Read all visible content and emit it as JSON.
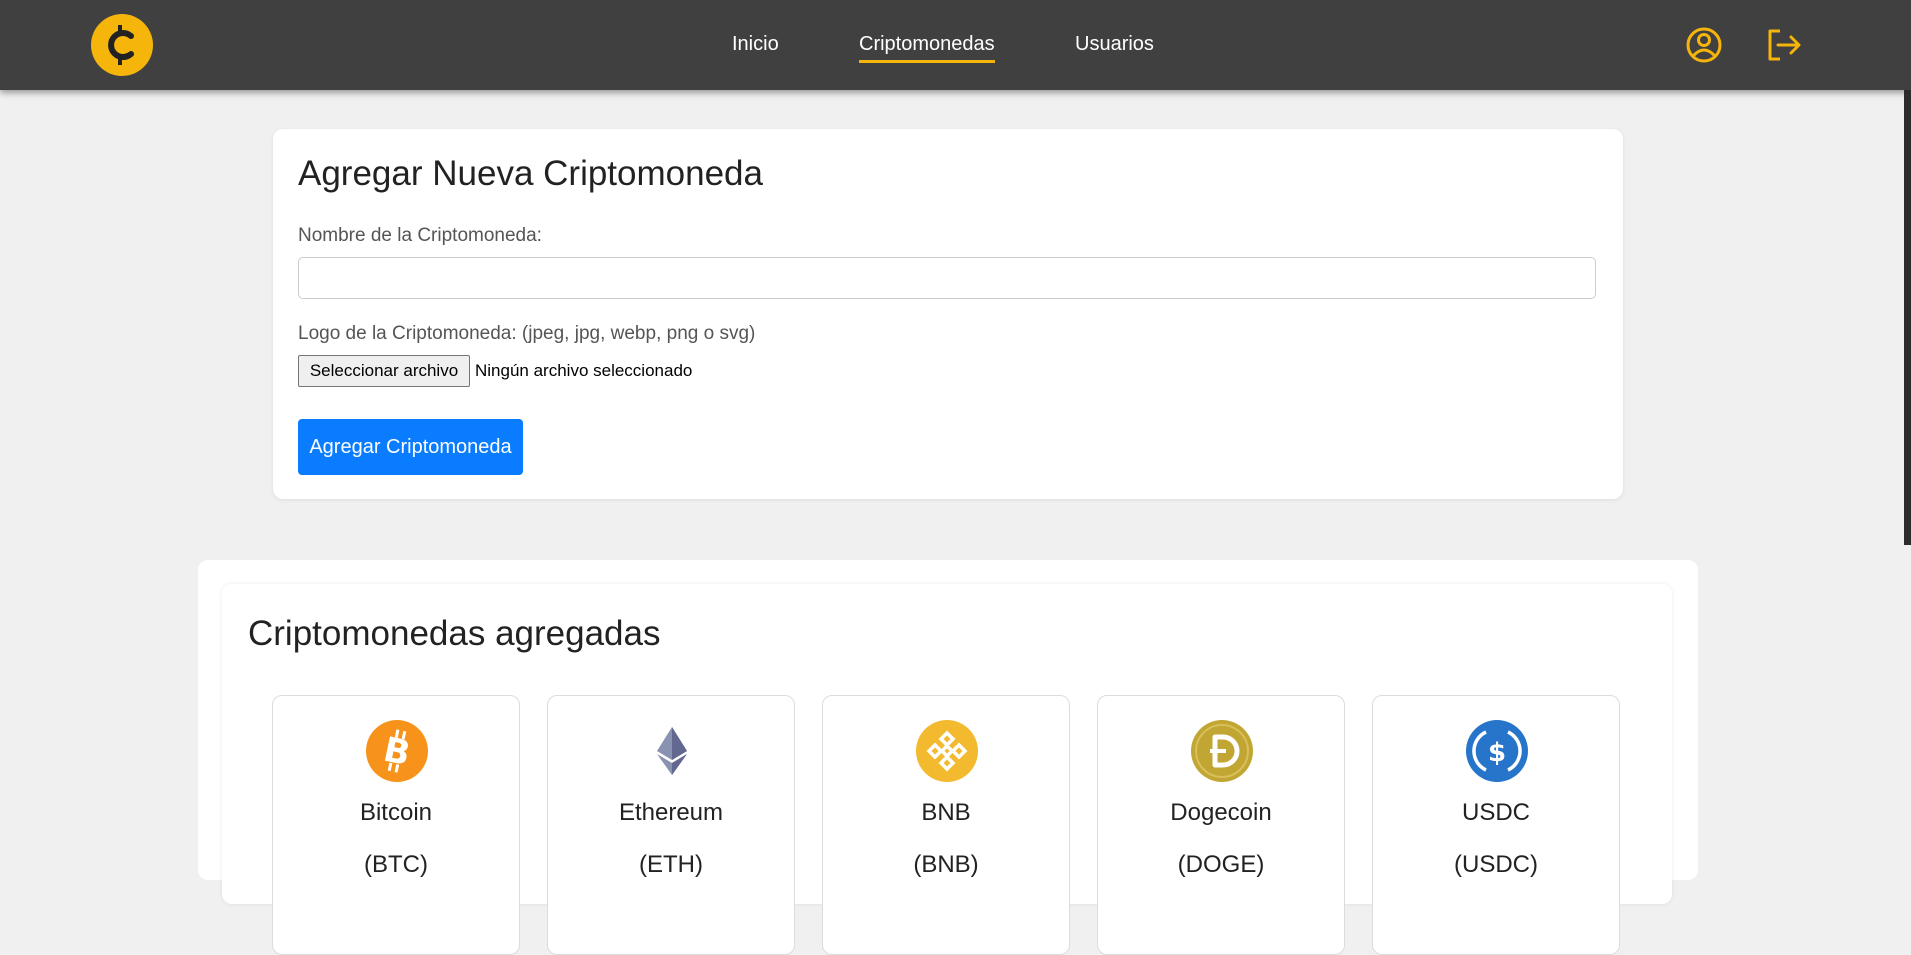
{
  "nav": {
    "links": [
      {
        "label": "Inicio"
      },
      {
        "label": "Criptomonedas",
        "active": true
      },
      {
        "label": "Usuarios"
      }
    ],
    "icons": {
      "logo": "crypto-coin-logo",
      "profile": "user-circle-icon",
      "logout": "logout-icon"
    },
    "accent_color": "#f5b50b"
  },
  "form": {
    "title": "Agregar Nueva Criptomoneda",
    "name_label": "Nombre de la Criptomoneda:",
    "name_value": "",
    "logo_label": "Logo de la Criptomoneda: (jpeg, jpg, webp, png o svg)",
    "file_button": "Seleccionar archivo",
    "file_status": "Ningún archivo seleccionado",
    "submit_label": "Agregar Criptomoneda",
    "submit_color": "#0a7cff"
  },
  "list": {
    "title": "Criptomonedas agregadas",
    "items": [
      {
        "name": "Bitcoin",
        "symbol": "(BTC)",
        "icon": "bitcoin-logo-icon",
        "color": "#f7931a"
      },
      {
        "name": "Ethereum",
        "symbol": "(ETH)",
        "icon": "ethereum-logo-icon",
        "color": "#627eea"
      },
      {
        "name": "BNB",
        "symbol": "(BNB)",
        "icon": "bnb-logo-icon",
        "color": "#f3ba2f"
      },
      {
        "name": "Dogecoin",
        "symbol": "(DOGE)",
        "icon": "dogecoin-logo-icon",
        "color": "#c2a633"
      },
      {
        "name": "USDC",
        "symbol": "(USDC)",
        "icon": "usdc-logo-icon",
        "color": "#2775ca"
      }
    ]
  }
}
